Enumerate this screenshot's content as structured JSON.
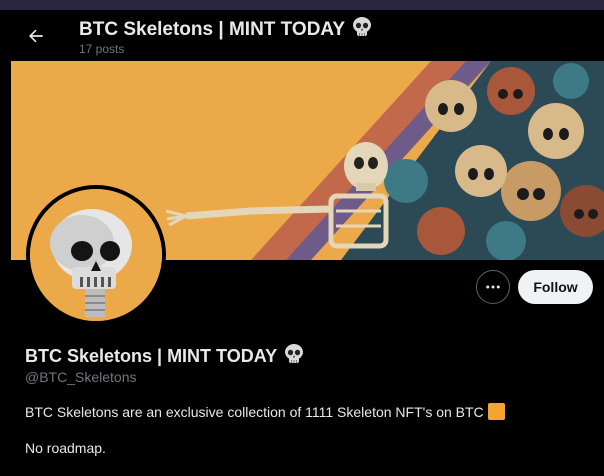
{
  "header": {
    "title": "BTC Skeletons | MINT TODAY",
    "post_count": "17 posts"
  },
  "profile": {
    "display_name": "BTC Skeletons | MINT TODAY",
    "handle": "@BTC_Skeletons",
    "bio_line1": "BTC Skeletons are an exclusive collection of 1111 Skeleton NFT's on BTC",
    "bio_line2": "No roadmap."
  },
  "actions": {
    "follow_label": "Follow"
  },
  "icons": {
    "back": "arrow-left-icon",
    "skull": "skull-emoji",
    "more": "more-horizontal-icon",
    "square": "orange-square-emoji"
  },
  "colors": {
    "background": "#000000",
    "banner_orange": "#eba94a",
    "secondary_text": "#71767b",
    "follow_button_bg": "#eff3f4"
  }
}
